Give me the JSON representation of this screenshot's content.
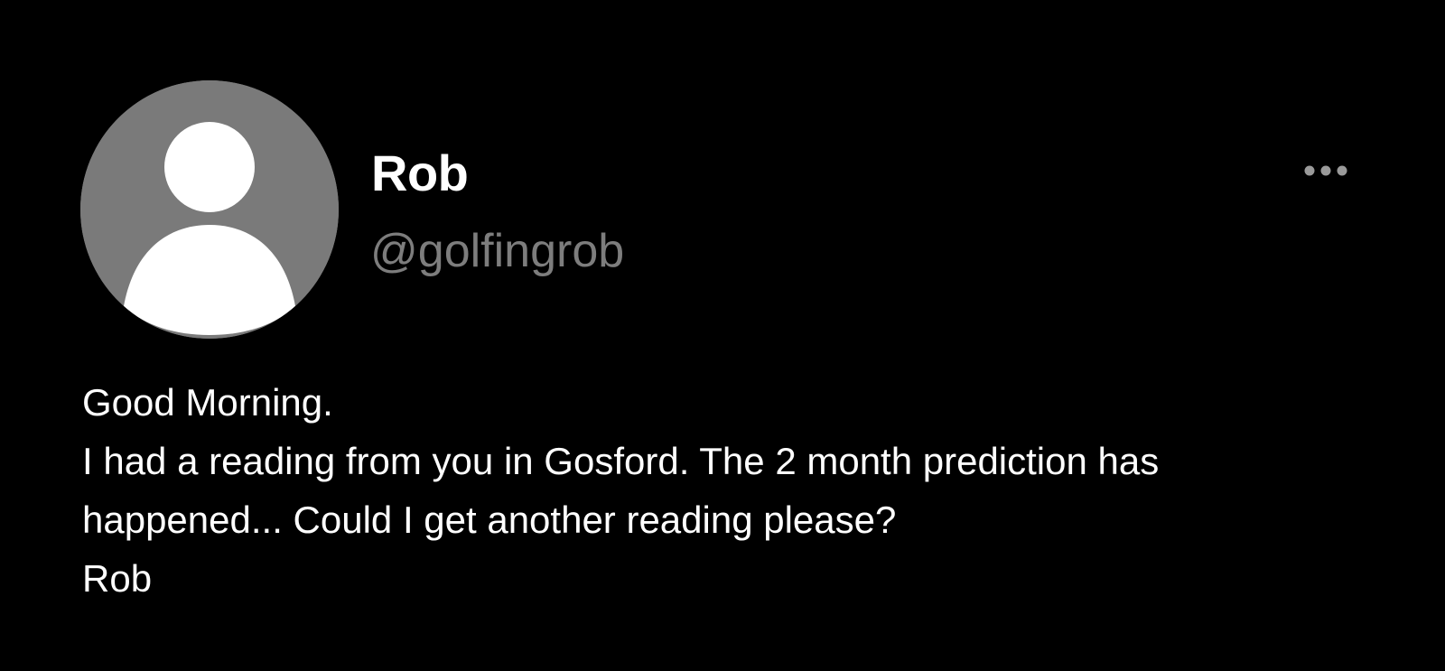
{
  "post": {
    "author": {
      "display_name": "Rob",
      "handle": "@golfingrob",
      "avatar_icon": "default-user-avatar-icon"
    },
    "menu_icon": "more-horizontal-icon",
    "body_lines": [
      "Good Morning.",
      "I had a reading from you in Gosford. The 2 month prediction has",
      "happened... Could I get another reading please?",
      "Rob"
    ]
  },
  "colors": {
    "background": "#000000",
    "text_primary": "#ffffff",
    "text_secondary": "#7d7d7d",
    "avatar_background": "#7a7a7a",
    "menu_dots": "#9a9a9a"
  }
}
